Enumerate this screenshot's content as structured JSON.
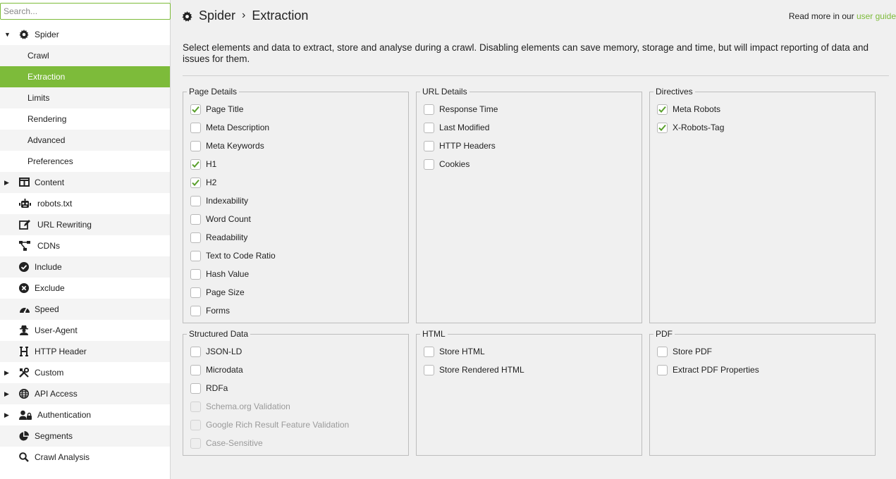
{
  "search": {
    "placeholder": "Search..."
  },
  "sidebar": {
    "items": [
      {
        "label": "Spider",
        "icon": "gear-icon",
        "expander": "down"
      },
      {
        "label": "Crawl"
      },
      {
        "label": "Extraction"
      },
      {
        "label": "Limits"
      },
      {
        "label": "Rendering"
      },
      {
        "label": "Advanced"
      },
      {
        "label": "Preferences"
      },
      {
        "label": "Content",
        "icon": "columns-icon",
        "expander": "right"
      },
      {
        "label": "robots.txt",
        "icon": "robot-icon"
      },
      {
        "label": "URL Rewriting",
        "icon": "edit-icon"
      },
      {
        "label": "CDNs",
        "icon": "network-icon"
      },
      {
        "label": "Include",
        "icon": "check-circle-icon"
      },
      {
        "label": "Exclude",
        "icon": "x-circle-icon"
      },
      {
        "label": "Speed",
        "icon": "gauge-icon"
      },
      {
        "label": "User-Agent",
        "icon": "user-secret-icon"
      },
      {
        "label": "HTTP Header",
        "icon": "heading-icon"
      },
      {
        "label": "Custom",
        "icon": "tools-icon",
        "expander": "right"
      },
      {
        "label": "API Access",
        "icon": "globe-icon",
        "expander": "right"
      },
      {
        "label": "Authentication",
        "icon": "user-lock-icon",
        "expander": "right"
      },
      {
        "label": "Segments",
        "icon": "pie-chart-icon"
      },
      {
        "label": "Crawl Analysis",
        "icon": "magnifier-icon"
      }
    ]
  },
  "header": {
    "section": "Spider",
    "separator": "›",
    "page": "Extraction"
  },
  "guide": {
    "prefix": "Read more in our",
    "link": "user guide"
  },
  "description": "Select elements and data to extract, store and analyse during a crawl. Disabling elements can save memory, storage and time, but will impact reporting of data and issues for them.",
  "groups": {
    "page_details": {
      "title": "Page Details",
      "options": [
        {
          "label": "Page Title",
          "checked": true
        },
        {
          "label": "Meta Description",
          "checked": false
        },
        {
          "label": "Meta Keywords",
          "checked": false
        },
        {
          "label": "H1",
          "checked": true
        },
        {
          "label": "H2",
          "checked": true
        },
        {
          "label": "Indexability",
          "checked": false
        },
        {
          "label": "Word Count",
          "checked": false
        },
        {
          "label": "Readability",
          "checked": false
        },
        {
          "label": "Text to Code Ratio",
          "checked": false
        },
        {
          "label": "Hash Value",
          "checked": false
        },
        {
          "label": "Page Size",
          "checked": false
        },
        {
          "label": "Forms",
          "checked": false
        }
      ]
    },
    "url_details": {
      "title": "URL Details",
      "options": [
        {
          "label": "Response Time",
          "checked": false
        },
        {
          "label": "Last Modified",
          "checked": false
        },
        {
          "label": "HTTP Headers",
          "checked": false
        },
        {
          "label": "Cookies",
          "checked": false
        }
      ]
    },
    "directives": {
      "title": "Directives",
      "options": [
        {
          "label": "Meta Robots",
          "checked": true
        },
        {
          "label": "X-Robots-Tag",
          "checked": true
        }
      ]
    },
    "structured_data": {
      "title": "Structured Data",
      "options": [
        {
          "label": "JSON-LD",
          "checked": false
        },
        {
          "label": "Microdata",
          "checked": false
        },
        {
          "label": "RDFa",
          "checked": false
        },
        {
          "label": "Schema.org Validation",
          "checked": false,
          "disabled": true
        },
        {
          "label": "Google Rich Result Feature Validation",
          "checked": false,
          "disabled": true
        },
        {
          "label": "Case-Sensitive",
          "checked": false,
          "disabled": true
        }
      ]
    },
    "html": {
      "title": "HTML",
      "options": [
        {
          "label": "Store HTML",
          "checked": false
        },
        {
          "label": "Store Rendered HTML",
          "checked": false
        }
      ]
    },
    "pdf": {
      "title": "PDF",
      "options": [
        {
          "label": "Store PDF",
          "checked": false
        },
        {
          "label": "Extract PDF Properties",
          "checked": false
        }
      ]
    }
  },
  "colors": {
    "accent": "#7dbb3a",
    "check": "#5aa02c"
  }
}
